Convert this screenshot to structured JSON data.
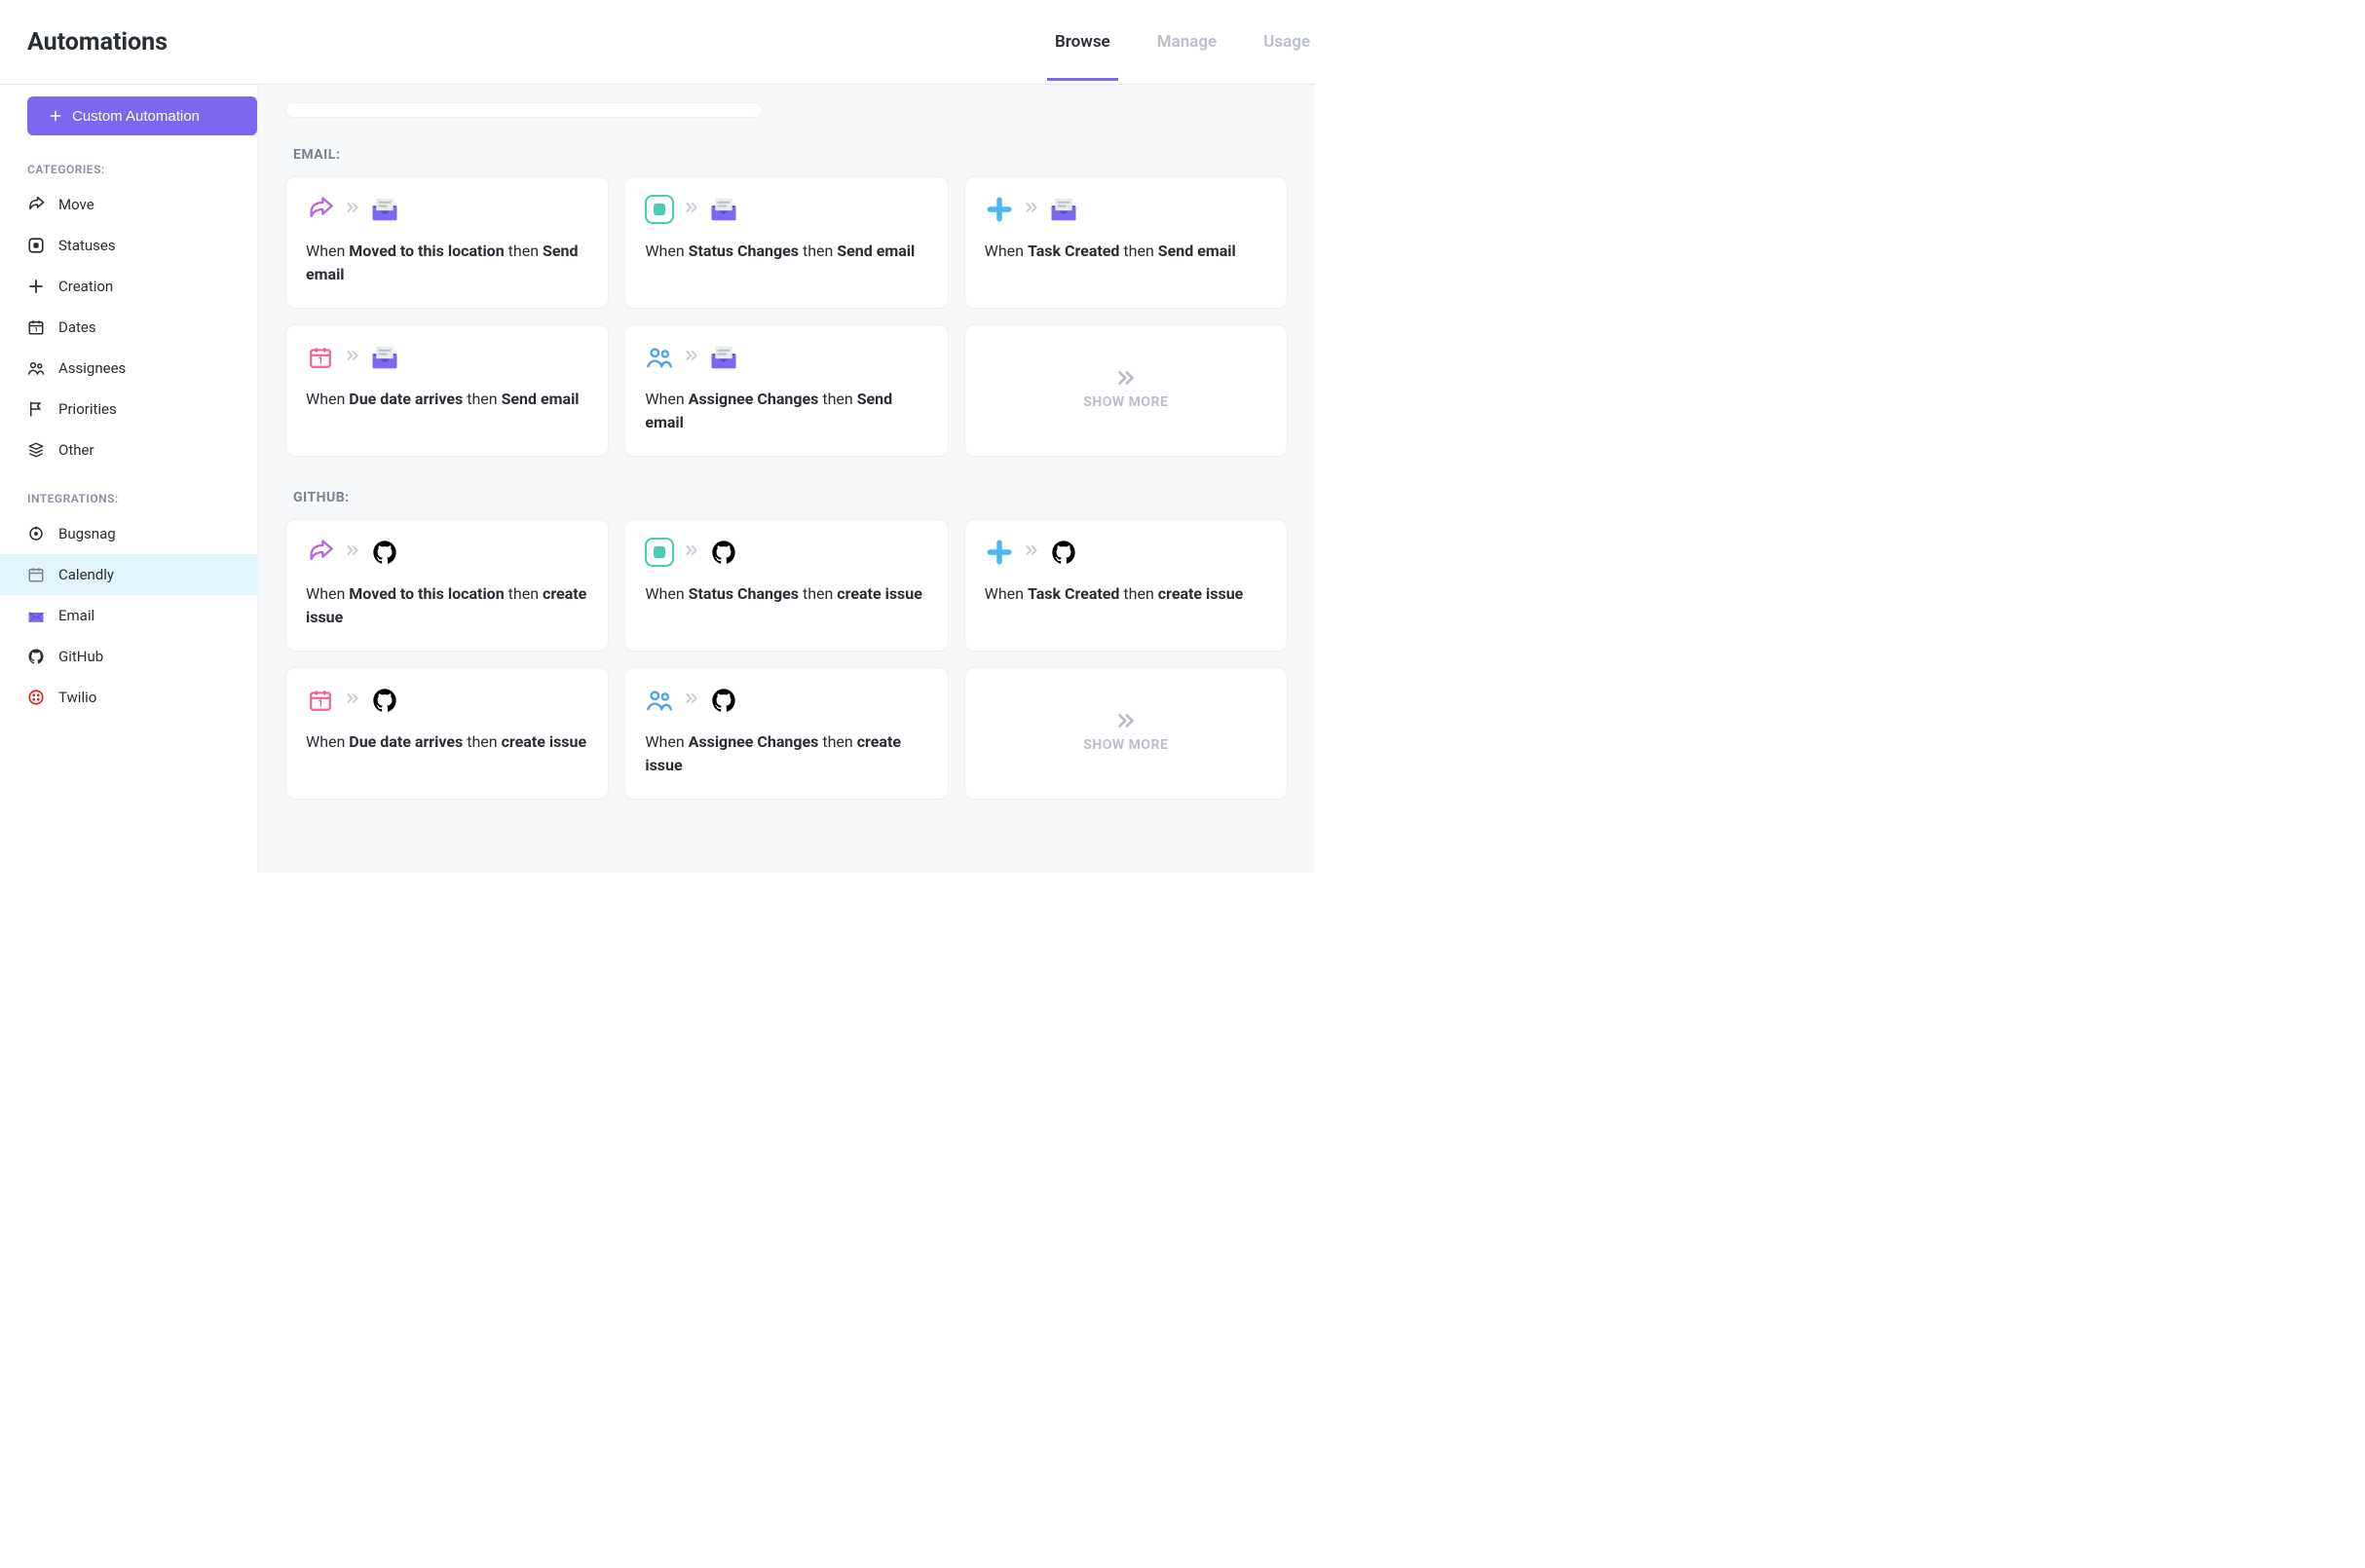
{
  "header": {
    "title": "Automations",
    "tabs": [
      "Browse",
      "Manage",
      "Usage"
    ],
    "activeTab": 0
  },
  "sidebar": {
    "customButton": "Custom Automation",
    "categoriesLabel": "CATEGORIES:",
    "categories": [
      {
        "label": "Move",
        "icon": "share"
      },
      {
        "label": "Statuses",
        "icon": "status"
      },
      {
        "label": "Creation",
        "icon": "plus"
      },
      {
        "label": "Dates",
        "icon": "calendar"
      },
      {
        "label": "Assignees",
        "icon": "people"
      },
      {
        "label": "Priorities",
        "icon": "flag"
      },
      {
        "label": "Other",
        "icon": "stack"
      }
    ],
    "integrationsLabel": "INTEGRATIONS:",
    "integrations": [
      {
        "label": "Bugsnag",
        "icon": "bugsnag",
        "selected": false
      },
      {
        "label": "Calendly",
        "icon": "calendly",
        "selected": true
      },
      {
        "label": "Email",
        "icon": "email",
        "selected": false
      },
      {
        "label": "GitHub",
        "icon": "github",
        "selected": false
      },
      {
        "label": "Twilio",
        "icon": "twilio",
        "selected": false
      }
    ]
  },
  "sections": [
    {
      "title": "EMAIL:",
      "actionIcon": "email",
      "cards": [
        {
          "triggerIcon": "share",
          "when": "When ",
          "trigger": "Moved to this location",
          "then": " then ",
          "action": "Send email"
        },
        {
          "triggerIcon": "status",
          "when": "When ",
          "trigger": "Status Changes",
          "then": " then ",
          "action": "Send email"
        },
        {
          "triggerIcon": "plus-blue",
          "when": "When ",
          "trigger": "Task Created",
          "then": " then ",
          "action": "Send email"
        },
        {
          "triggerIcon": "calendar-pink",
          "when": "When ",
          "trigger": "Due date arrives",
          "then": " then ",
          "action": "Send email"
        },
        {
          "triggerIcon": "people-blue",
          "when": "When ",
          "trigger": "Assignee Changes",
          "then": " then ",
          "action": "Send email"
        }
      ],
      "showMore": "SHOW MORE"
    },
    {
      "title": "GITHUB:",
      "actionIcon": "github",
      "cards": [
        {
          "triggerIcon": "share",
          "when": "When ",
          "trigger": "Moved to this location",
          "then": " then ",
          "action": "create issue"
        },
        {
          "triggerIcon": "status",
          "when": "When ",
          "trigger": "Status Changes",
          "then": " then ",
          "action": "create issue"
        },
        {
          "triggerIcon": "plus-blue",
          "when": "When ",
          "trigger": "Task Created",
          "then": " then ",
          "action": "create issue"
        },
        {
          "triggerIcon": "calendar-pink",
          "when": "When ",
          "trigger": "Due date arrives",
          "then": " then ",
          "action": "create issue"
        },
        {
          "triggerIcon": "people-blue",
          "when": "When ",
          "trigger": "Assignee Changes",
          "then": " then ",
          "action": "create issue"
        }
      ],
      "showMore": "SHOW MORE"
    }
  ]
}
